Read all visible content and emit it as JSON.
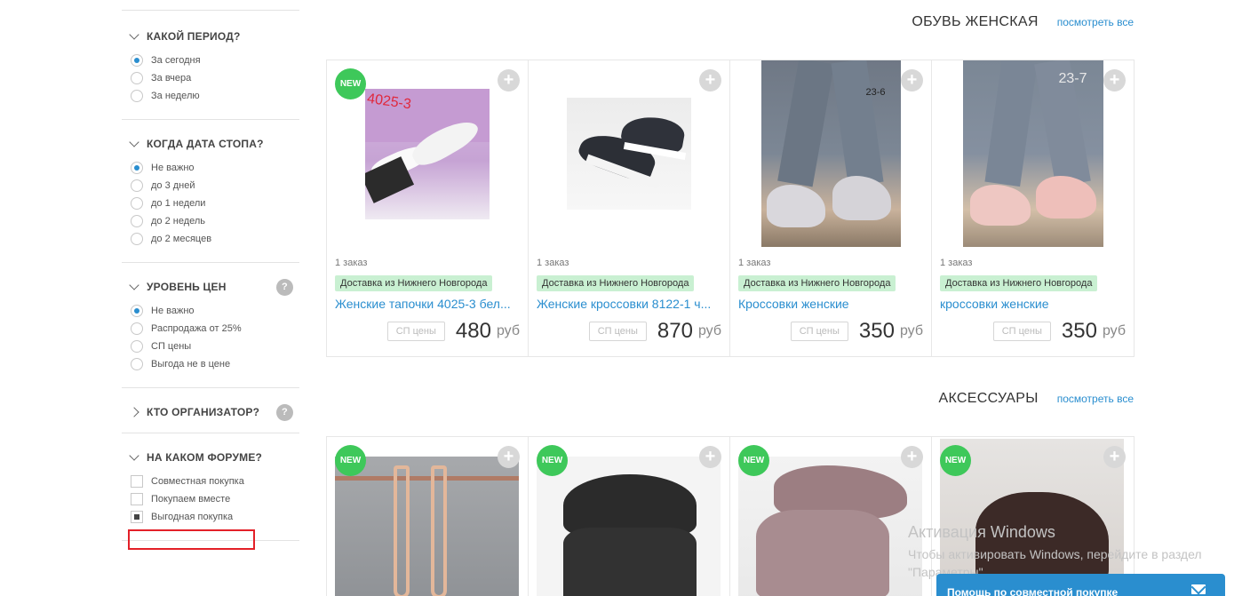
{
  "filters": {
    "period": {
      "title": "КАКОЙ ПЕРИОД?",
      "options": [
        "За сегодня",
        "За вчера",
        "За неделю"
      ],
      "selected": 0
    },
    "stop_date": {
      "title": "КОГДА ДАТА СТОПА?",
      "options": [
        "Не важно",
        "до 3 дней",
        "до 1 недели",
        "до 2 недель",
        "до 2 месяцев"
      ],
      "selected": 0
    },
    "price_level": {
      "title": "УРОВЕНЬ ЦЕН",
      "help": "?",
      "options": [
        "Не важно",
        "Распродажа от 25%",
        "СП цены",
        "Выгода не в цене"
      ],
      "selected": 0
    },
    "organizer": {
      "title": "КТО ОРГАНИЗАТОР?",
      "help": "?"
    },
    "forum": {
      "title": "НА КАКОМ ФОРУМЕ?",
      "options": [
        "Совместная покупка",
        "Покупаем вместе",
        "Выгодная покупка"
      ],
      "checked": [
        false,
        false,
        true
      ]
    }
  },
  "sections": [
    {
      "title": "ОБУВЬ ЖЕНСКАЯ",
      "see_all": "посмотреть все",
      "products": [
        {
          "badge": "NEW",
          "orders": "1 заказ",
          "delivery": "Доставка из Нижнего Новгорода",
          "name": "Женские тапочки 4025-3 бел...",
          "sp": "СП цены",
          "price": "480",
          "currency": "руб",
          "photo_label": "4025-3"
        },
        {
          "badge": "",
          "orders": "1 заказ",
          "delivery": "Доставка из Нижнего Новгорода",
          "name": "Женские кроссовки 8122-1 ч...",
          "sp": "СП цены",
          "price": "870",
          "currency": "руб",
          "photo_label": ""
        },
        {
          "badge": "",
          "orders": "1 заказ",
          "delivery": "Доставка из Нижнего Новгорода",
          "name": "Кроссовки женские",
          "sp": "СП цены",
          "price": "350",
          "currency": "руб",
          "photo_label": "23-6"
        },
        {
          "badge": "",
          "orders": "1 заказ",
          "delivery": "Доставка из Нижнего Новгорода",
          "name": "кроссовки женские",
          "sp": "СП цены",
          "price": "350",
          "currency": "руб",
          "photo_label": "23-7"
        }
      ]
    },
    {
      "title": "АКСЕССУАРЫ",
      "see_all": "посмотреть все",
      "products": [
        {
          "badge": "NEW"
        },
        {
          "badge": "NEW"
        },
        {
          "badge": "NEW"
        },
        {
          "badge": "NEW"
        }
      ]
    }
  ],
  "plus_label": "+",
  "watermark": {
    "title": "Активация Windows",
    "subtitle": "Чтобы активировать Windows, перейдите в раздел \"Параметры\"."
  },
  "help_bar": {
    "label": "Помощь по совместной покупке"
  },
  "colors": {
    "accent": "#2a8ecf",
    "new_badge": "#3ec85a",
    "delivery_bg": "#c9f0d2",
    "highlight": "#e32028"
  }
}
